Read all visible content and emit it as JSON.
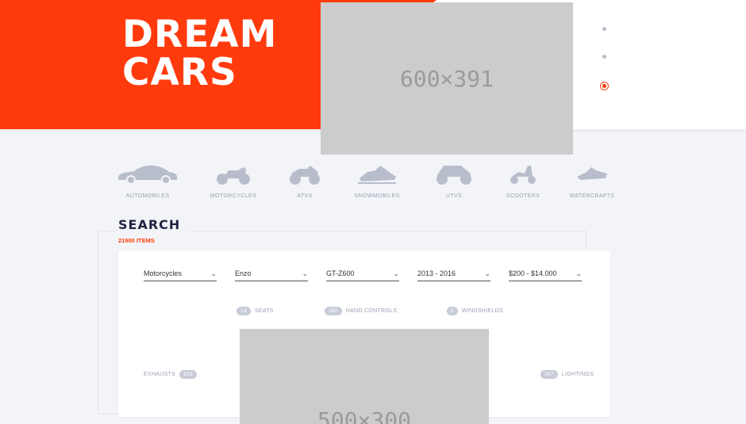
{
  "hero": {
    "title_line1": "DREAM",
    "title_line2": "CARS",
    "image_label": "600×391",
    "accent_color": "#ff3b0d"
  },
  "slider_dots": [
    {
      "active": false
    },
    {
      "active": false
    },
    {
      "active": true
    }
  ],
  "categories": [
    {
      "label": "AUTOMOBILES",
      "icon": "car-icon"
    },
    {
      "label": "MOTORCYCLES",
      "icon": "motorcycle-icon"
    },
    {
      "label": "ATVS",
      "icon": "atv-icon"
    },
    {
      "label": "SNOWMOBILES",
      "icon": "snowmobile-icon"
    },
    {
      "label": "UTVS",
      "icon": "utv-icon"
    },
    {
      "label": "SCOOTERS",
      "icon": "scooter-icon"
    },
    {
      "label": "WATERCRAFTS",
      "icon": "watercraft-icon"
    }
  ],
  "search": {
    "title": "SEARCH",
    "count": "21900 ITEMS",
    "filters": [
      {
        "value": "Motorcycles"
      },
      {
        "value": "Enzo"
      },
      {
        "value": "GT-Z600"
      },
      {
        "value": "2013 - 2016"
      },
      {
        "value": "$200 - $14.000"
      }
    ],
    "tags": {
      "seats": {
        "count": "14",
        "label": "SEATS"
      },
      "hand_controls": {
        "count": "260",
        "label": "HAND CONTROLS"
      },
      "windshields": {
        "count": "2",
        "label": "WINDSHIELDS"
      },
      "exhausts": {
        "count": "103",
        "label": "EXHAUSTS"
      },
      "lightings": {
        "count": "267",
        "label": "LIGHTINGS"
      }
    },
    "image_label": "500×300"
  }
}
